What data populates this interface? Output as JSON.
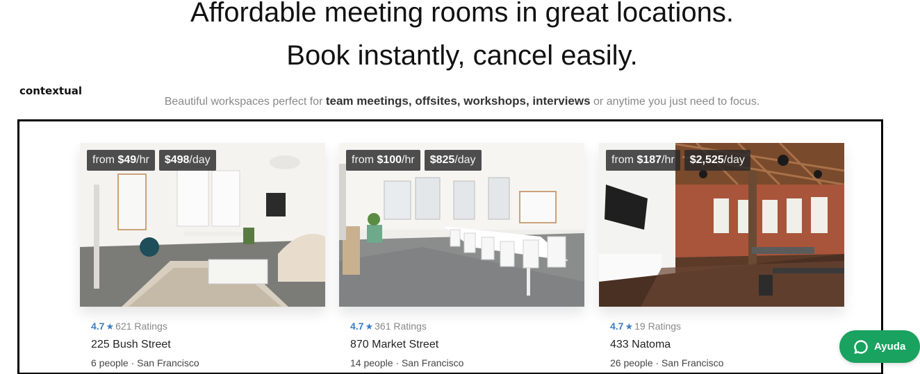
{
  "hero": {
    "line1": "Affordable meeting rooms in great locations.",
    "line2": "Book instantly, cancel easily."
  },
  "side_label": "contextual",
  "subtitle": {
    "prefix": "Beautiful workspaces perfect for ",
    "bold": "team meetings, offsites, workshops, interviews",
    "suffix": " or anytime you just need to focus."
  },
  "listings": [
    {
      "hourly_prefix": "from ",
      "hourly_amount": "$49",
      "hourly_unit": "/hr",
      "daily_amount": "$498",
      "daily_unit": "/day",
      "rating": "4.7",
      "ratings_count": "621 Ratings",
      "address": "225 Bush Street",
      "capacity": "6 people",
      "city": "San Francisco"
    },
    {
      "hourly_prefix": "from ",
      "hourly_amount": "$100",
      "hourly_unit": "/hr",
      "daily_amount": "$825",
      "daily_unit": "/day",
      "rating": "4.7",
      "ratings_count": "361 Ratings",
      "address": "870 Market Street",
      "capacity": "14 people",
      "city": "San Francisco"
    },
    {
      "hourly_prefix": "from ",
      "hourly_amount": "$187",
      "hourly_unit": "/hr",
      "daily_amount": "$2,525",
      "daily_unit": "/day",
      "rating": "4.7",
      "ratings_count": "19 Ratings",
      "address": "433 Natoma",
      "capacity": "26 people",
      "city": "San Francisco"
    }
  ],
  "separator": " · ",
  "star_glyph": "★",
  "help_button": {
    "label": "Ayuda",
    "icon": "chat-bubble-icon",
    "color": "#1aa260"
  },
  "colors": {
    "rating_accent": "#3b7fc4",
    "frame": "#000000"
  }
}
